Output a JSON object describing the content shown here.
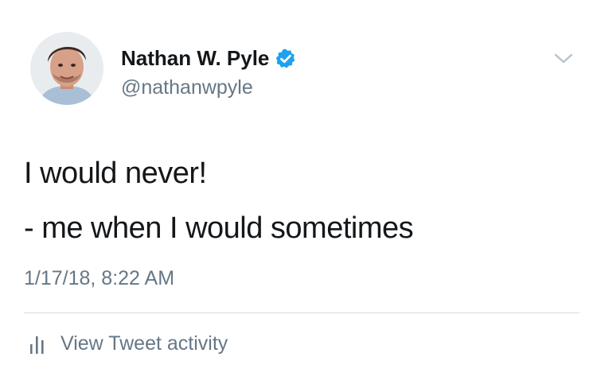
{
  "tweet": {
    "author": {
      "display_name": "Nathan W. Pyle",
      "handle": "@nathanwpyle",
      "verified_icon": "verified-badge-icon",
      "verified_color": "#1da1f2"
    },
    "text_lines": [
      "I would never!",
      "- me when I would sometimes"
    ],
    "timestamp": "1/17/18, 8:22 AM",
    "activity_label": "View Tweet activity",
    "activity_icon": "bar-chart-icon",
    "menu_icon": "chevron-down-icon"
  },
  "colors": {
    "text_primary": "#14171a",
    "text_secondary": "#657786",
    "divider": "#d8dde2",
    "accent": "#1da1f2"
  }
}
